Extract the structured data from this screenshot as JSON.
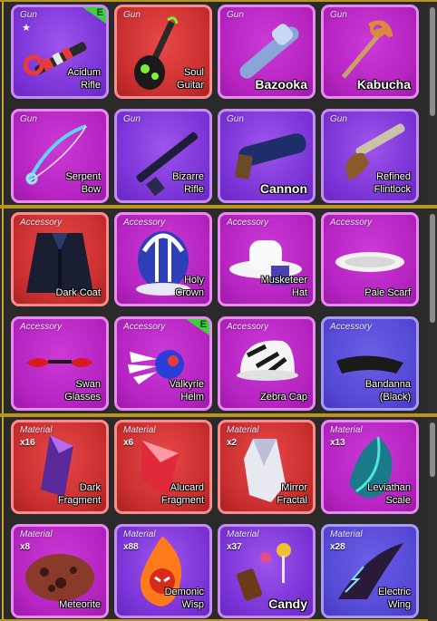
{
  "sections": [
    {
      "key": "guns",
      "items": [
        {
          "category": "Gun",
          "name": "Acidum\nRifle",
          "big": false,
          "color": "purple",
          "star": true,
          "badge": "E",
          "icon": "acid-rifle-icon"
        },
        {
          "category": "Gun",
          "name": "Soul\nGuitar",
          "big": false,
          "color": "red",
          "icon": "soul-guitar-icon"
        },
        {
          "category": "Gun",
          "name": "Bazooka",
          "big": true,
          "color": "pink",
          "icon": "bazooka-icon"
        },
        {
          "category": "Gun",
          "name": "Kabucha",
          "big": true,
          "color": "pink",
          "icon": "kabucha-icon"
        },
        {
          "category": "Gun",
          "name": "Serpent\nBow",
          "big": false,
          "color": "pink",
          "icon": "serpent-bow-icon"
        },
        {
          "category": "Gun",
          "name": "Bizarre\nRifle",
          "big": false,
          "color": "purple",
          "icon": "bizarre-rifle-icon"
        },
        {
          "category": "Gun",
          "name": "Cannon",
          "big": true,
          "color": "purple",
          "icon": "cannon-icon"
        },
        {
          "category": "Gun",
          "name": "Refined\nFlintlock",
          "big": false,
          "color": "purple",
          "icon": "flintlock-icon"
        }
      ]
    },
    {
      "key": "accessories",
      "items": [
        {
          "category": "Accessory",
          "name": "Dark Coat",
          "big": false,
          "color": "red",
          "icon": "dark-coat-icon"
        },
        {
          "category": "Accessory",
          "name": "Holy\nCrown",
          "big": false,
          "color": "pink",
          "icon": "holy-crown-icon"
        },
        {
          "category": "Accessory",
          "name": "Musketeer\nHat",
          "big": false,
          "color": "pink",
          "icon": "musketeer-hat-icon"
        },
        {
          "category": "Accessory",
          "name": "Pale Scarf",
          "big": false,
          "color": "pink",
          "icon": "pale-scarf-icon"
        },
        {
          "category": "Accessory",
          "name": "Swan\nGlasses",
          "big": false,
          "color": "pink",
          "icon": "swan-glasses-icon"
        },
        {
          "category": "Accessory",
          "name": "Valkyrie\nHelm",
          "big": false,
          "color": "pink",
          "badge": "E",
          "icon": "valkyrie-helm-icon"
        },
        {
          "category": "Accessory",
          "name": "Zebra Cap",
          "big": false,
          "color": "pink",
          "icon": "zebra-cap-icon"
        },
        {
          "category": "Accessory",
          "name": "Bandanna\n(Black)",
          "big": false,
          "color": "blue",
          "icon": "bandanna-icon"
        }
      ]
    },
    {
      "key": "materials",
      "items": [
        {
          "category": "Material",
          "qty": "x16",
          "name": "Dark\nFragment",
          "big": false,
          "color": "red",
          "icon": "dark-fragment-icon"
        },
        {
          "category": "Material",
          "qty": "x6",
          "name": "Alucard\nFragment",
          "big": false,
          "color": "red",
          "icon": "alucard-fragment-icon"
        },
        {
          "category": "Material",
          "qty": "x2",
          "name": "Mirror\nFractal",
          "big": false,
          "color": "red",
          "icon": "mirror-fractal-icon"
        },
        {
          "category": "Material",
          "qty": "x13",
          "name": "Leviathan\nScale",
          "big": false,
          "color": "pink",
          "icon": "leviathan-scale-icon"
        },
        {
          "category": "Material",
          "qty": "x8",
          "name": "Meteorite",
          "big": false,
          "color": "pink",
          "icon": "meteorite-icon"
        },
        {
          "category": "Material",
          "qty": "x88",
          "name": "Demonic\nWisp",
          "big": false,
          "color": "purple",
          "icon": "demonic-wisp-icon"
        },
        {
          "category": "Material",
          "qty": "x37",
          "name": "Candy",
          "big": true,
          "color": "purple",
          "icon": "candy-icon"
        },
        {
          "category": "Material",
          "qty": "x28",
          "name": "Electric\nWing",
          "big": false,
          "color": "blue",
          "icon": "electric-wing-icon"
        }
      ]
    }
  ],
  "colors": {
    "purple": "#7a33d6",
    "red": "#c92e2e",
    "pink": "#b523c0",
    "blue": "#5448d6",
    "band_border": "#b8951f",
    "badge": "#3bd23b"
  }
}
